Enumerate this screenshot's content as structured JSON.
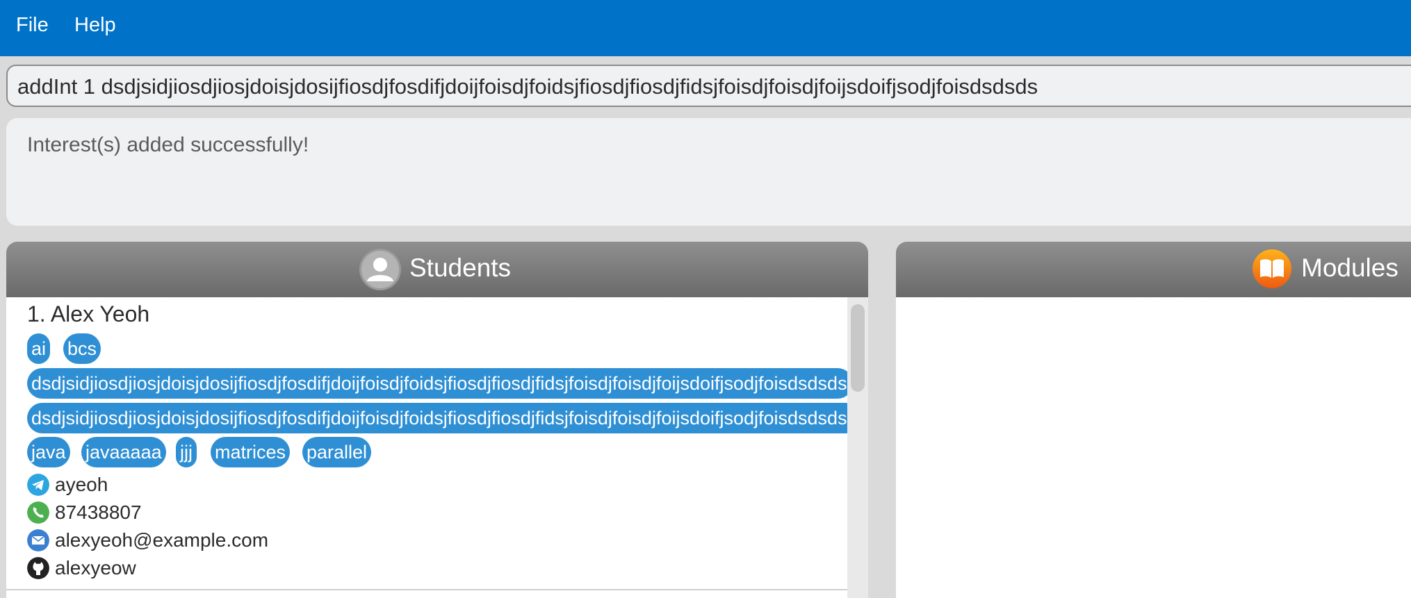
{
  "menu": {
    "file": "File",
    "help": "Help"
  },
  "command": {
    "value": "addInt 1 dsdjsidjiosdjiosjdoisjdosijfiosdjfosdifjdoijfoisdjfoidsjfiosdjfiosdjfidsjfoisdjfoisdjfoijsdoifjsodjfoisdsdsds"
  },
  "result": {
    "text": "Interest(s) added successfully!"
  },
  "students_panel": {
    "title": "Students",
    "icon": "person-icon"
  },
  "modules_panel": {
    "title": "Modules",
    "icon": "book-icon"
  },
  "students": [
    {
      "index_name": "1. Alex Yeoh",
      "tags": [
        "ai",
        "bcs",
        "dsdjsidjiosdjiosjdoisjdosijfiosdjfosdifjdoijfoisdjfoidsjfiosdjfiosdjfidsjfoisdjfoisdjfoijsdoifjsodjfoisdsdsds",
        "dsdjsidjiosdjiosjdoisjdosijfiosdjfosdifjdoijfoisdjfoidsjfiosdjfiosdjfidsjfoisdjfoisdjfoijsdoifjsodjfoisdsdsdsds",
        "java",
        "javaaaaa",
        "jjj",
        "matrices",
        "parallel"
      ],
      "telegram": "ayeoh",
      "phone": "87438807",
      "email": "alexyeoh@example.com",
      "github": "alexyeow"
    }
  ],
  "colors": {
    "menubar": "#0073c9",
    "tag": "#2f8fd4",
    "header": "#7d7d7d",
    "telegram": "#2ca5e0",
    "phone": "#4caf50",
    "email": "#3b7fd0",
    "github": "#222222"
  }
}
